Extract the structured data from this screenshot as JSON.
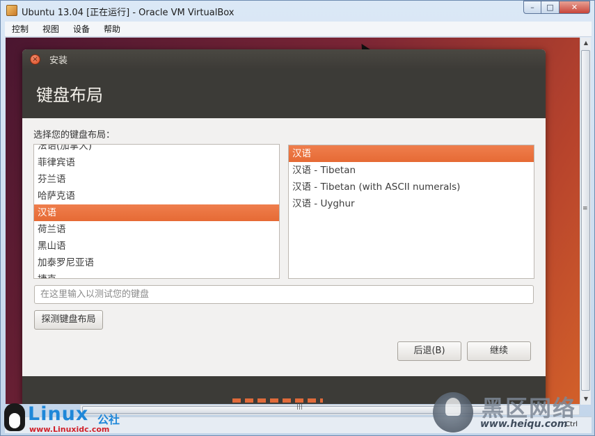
{
  "window": {
    "title": "Ubuntu 13.04 [正在运行] - Oracle VM VirtualBox",
    "controls": {
      "minimize": "–",
      "maximize": "□",
      "close": "✕"
    }
  },
  "menubar": [
    "控制",
    "视图",
    "设备",
    "帮助"
  ],
  "installer": {
    "window_title": "安装",
    "heading": "键盘布局",
    "prompt": "选择您的键盘布局：",
    "layouts": [
      {
        "label": "法语(加拿大)",
        "selected": false
      },
      {
        "label": "菲律宾语",
        "selected": false
      },
      {
        "label": "芬兰语",
        "selected": false
      },
      {
        "label": "哈萨克语",
        "selected": false
      },
      {
        "label": "汉语",
        "selected": true
      },
      {
        "label": "荷兰语",
        "selected": false
      },
      {
        "label": "黑山语",
        "selected": false
      },
      {
        "label": "加泰罗尼亚语",
        "selected": false
      },
      {
        "label": "捷克",
        "selected": false
      }
    ],
    "variants": [
      {
        "label": "汉语",
        "selected": true
      },
      {
        "label": "汉语 - Tibetan",
        "selected": false
      },
      {
        "label": "汉语 - Tibetan (with ASCII numerals)",
        "selected": false
      },
      {
        "label": "汉语 - Uyghur",
        "selected": false
      }
    ],
    "test_input_placeholder": "在这里输入以测试您的键盘",
    "detect_button": "探测键盘布局",
    "back_button": "后退(B)",
    "continue_button": "继续"
  },
  "statusbar": {
    "host_key": "Ctrl"
  },
  "watermarks": {
    "linux_word": "Linux",
    "linux_suffix": "公社",
    "linux_url": "www.Linuxidc.com",
    "heiqu_title": "黑区网络",
    "heiqu_url": "www.heiqu.com"
  },
  "colors": {
    "accent_orange": "#e66a35",
    "dialog_dark": "#3c3b37",
    "linux_blue": "#1f87d8"
  }
}
